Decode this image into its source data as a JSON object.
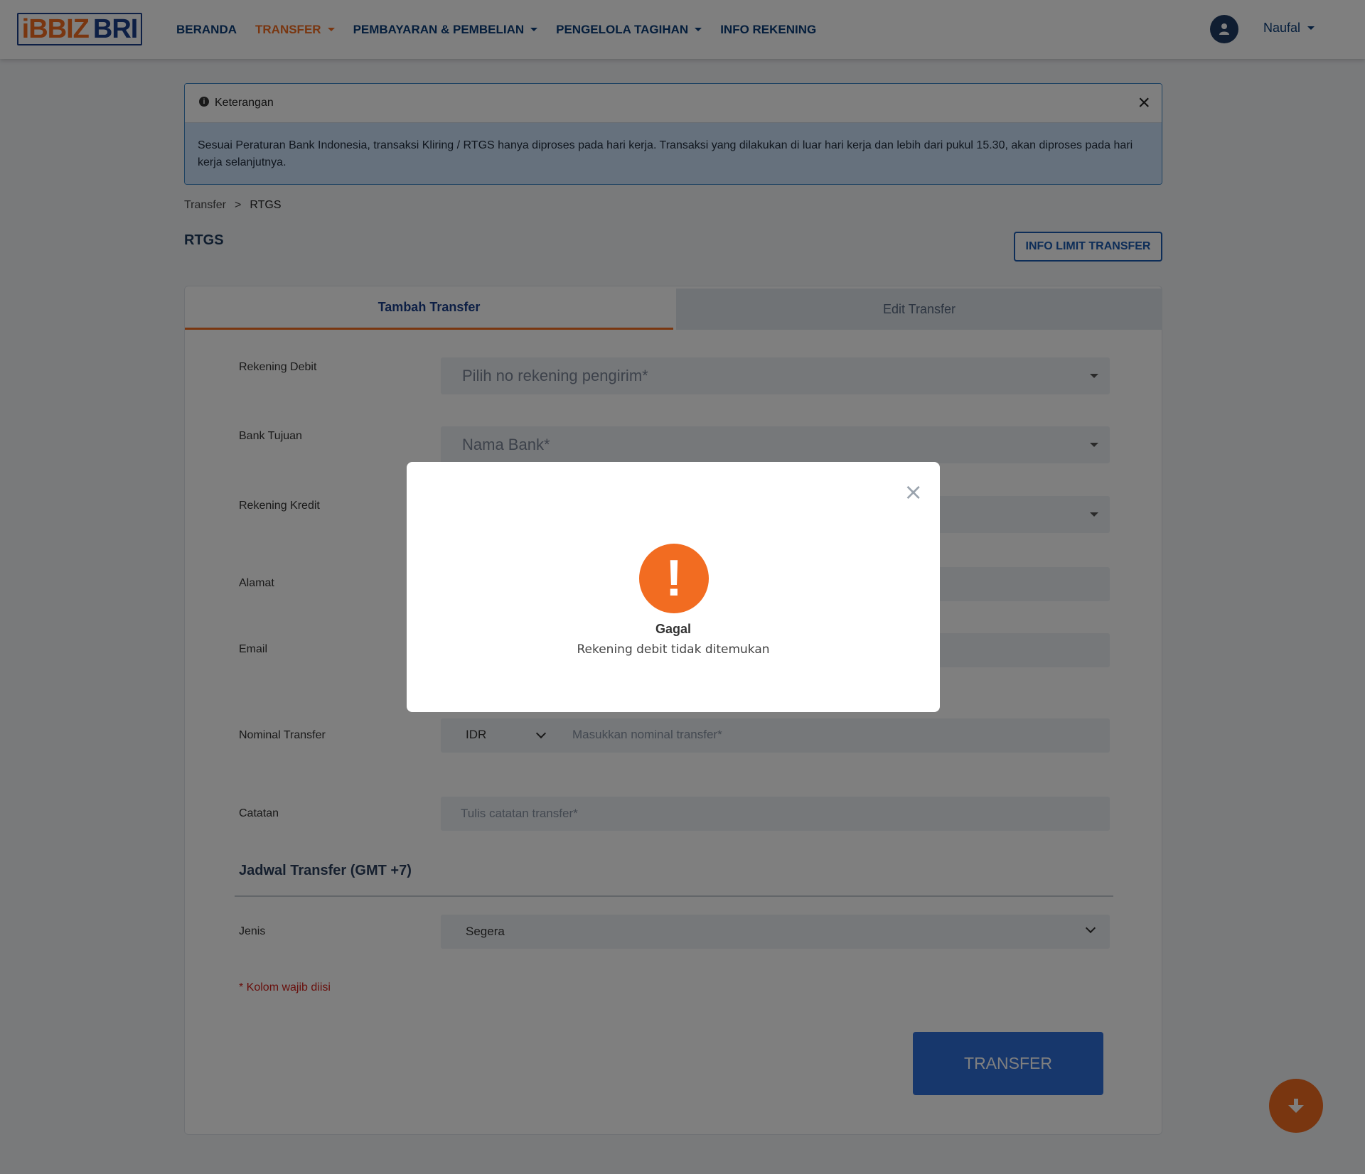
{
  "header": {
    "logo_ib": "iBBIZ",
    "logo_bri": "BRI",
    "nav": [
      {
        "label": "BERANDA",
        "has_caret": false,
        "active": false
      },
      {
        "label": "TRANSFER",
        "has_caret": true,
        "active": true
      },
      {
        "label": "PEMBAYARAN & PEMBELIAN",
        "has_caret": true,
        "active": false
      },
      {
        "label": "PENGELOLA TAGIHAN",
        "has_caret": true,
        "active": false
      },
      {
        "label": "INFO REKENING",
        "has_caret": false,
        "active": false
      }
    ],
    "user_name": "Naufal"
  },
  "info_alert": {
    "title": "Keterangan",
    "icon": "info-icon",
    "body": "Sesuai Peraturan Bank Indonesia, transaksi Kliring / RTGS hanya diproses pada hari kerja. Transaksi yang dilakukan di luar hari kerja dan lebih dari pukul 15.30, akan diproses pada hari kerja selanjutnya."
  },
  "breadcrumb": {
    "items": [
      "Transfer",
      "RTGS"
    ],
    "separator": ">"
  },
  "page_title": "RTGS",
  "info_limit_button": "INFO LIMIT TRANSFER",
  "tabs": {
    "add": "Tambah Transfer",
    "edit": "Edit Transfer"
  },
  "form": {
    "rekening_debit": {
      "label": "Rekening Debit",
      "placeholder": "Pilih no rekening pengirim*"
    },
    "bank_tujuan": {
      "label": "Bank Tujuan",
      "placeholder": "Nama Bank*"
    },
    "rekening_kredit": {
      "label": "Rekening Kredit"
    },
    "alamat": {
      "label": "Alamat"
    },
    "email": {
      "label": "Email"
    },
    "nominal": {
      "label": "Nominal Transfer",
      "currency": "IDR",
      "placeholder": "Masukkan nominal transfer*"
    },
    "catatan": {
      "label": "Catatan",
      "placeholder": "Tulis catatan transfer*"
    },
    "schedule_title": "Jadwal Transfer (GMT +7)",
    "jenis": {
      "label": "Jenis",
      "value": "Segera"
    },
    "required_note": "* Kolom wajib diisi",
    "submit": "TRANSFER"
  },
  "modal": {
    "icon": "exclamation-icon",
    "glyph": "!",
    "title": "Gagal",
    "message": "Rekening debit tidak ditemukan",
    "close_glyph": "×"
  },
  "colors": {
    "brand_orange": "#f26c21",
    "brand_blue": "#1a3f8a",
    "button_blue": "#2f6ed9"
  }
}
